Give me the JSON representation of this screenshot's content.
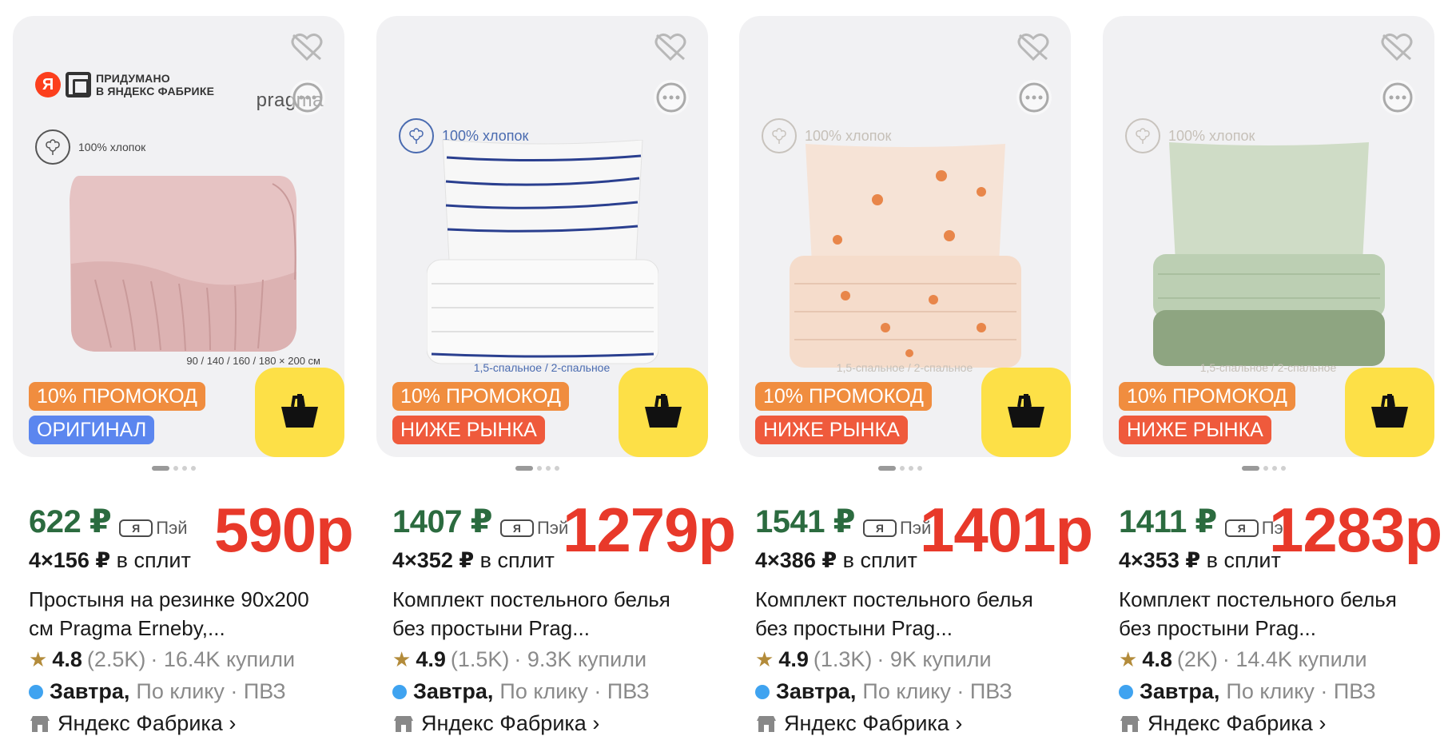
{
  "colors": {
    "price_green": "#2b6b3f",
    "big_price_red": "#e8392a",
    "promo_orange": "#f08d3f",
    "original_blue": "#5b86ef",
    "below_market_red": "#ef5a3c",
    "cart_yellow": "#fde047",
    "delivery_blue": "#3fa3f0"
  },
  "cards": [
    {
      "brand_line1": "ПРИДУМАНО",
      "brand_line2": "В ЯНДЕКС ФАБРИКЕ",
      "ya_letter": "Я",
      "pragma": "pragma",
      "cotton": "100% хлопок",
      "size_note": "90 / 140 / 160 / 180 × 200 см",
      "badge_top": "10% ПРОМОКОД",
      "badge_bottom": "ОРИГИНАЛ",
      "price": "622 ₽",
      "pay_label": "Пэй",
      "pay_icon": "Я",
      "big_price": "590р",
      "split_amount": "4×156 ₽",
      "split_label": "в сплит",
      "title": "Простыня на резинке 90x200 см Pragma Erneby,...",
      "rating": "4.8",
      "reviews": "(2.5K)",
      "bought": "· 16.4K купили",
      "delivery_day": "Завтра,",
      "delivery_rest": "По клику · ПВЗ",
      "store": "Яндекс Фабрика ›",
      "icons": [
        "heart-off-icon",
        "more-icon",
        "cart-icon",
        "star-icon",
        "store-icon"
      ]
    },
    {
      "cotton": "100% хлопок",
      "size_note": "1,5-спальное / 2-спальное",
      "badge_top": "10% ПРОМОКОД",
      "badge_bottom": "НИЖЕ РЫНКА",
      "price": "1407 ₽",
      "pay_label": "Пэй",
      "pay_icon": "Я",
      "big_price": "1279р",
      "split_amount": "4×352 ₽",
      "split_label": "в сплит",
      "title": "Комплект постельного белья без простыни Prag...",
      "rating": "4.9",
      "reviews": "(1.5K)",
      "bought": "· 9.3K купили",
      "delivery_day": "Завтра,",
      "delivery_rest": "По клику · ПВЗ",
      "store": "Яндекс Фабрика ›"
    },
    {
      "cotton": "100% хлопок",
      "size_note": "1,5-спальное / 2-спальное",
      "badge_top": "10% ПРОМОКОД",
      "badge_bottom": "НИЖЕ РЫНКА",
      "price": "1541 ₽",
      "pay_label": "Пэй",
      "pay_icon": "Я",
      "big_price": "1401р",
      "split_amount": "4×386 ₽",
      "split_label": "в сплит",
      "title": "Комплект постельного белья без простыни Prag...",
      "rating": "4.9",
      "reviews": "(1.3K)",
      "bought": "· 9K купили",
      "delivery_day": "Завтра,",
      "delivery_rest": "По клику · ПВЗ",
      "store": "Яндекс Фабрика ›"
    },
    {
      "cotton": "100% хлопок",
      "size_note": "1,5-спальное / 2-спальное",
      "badge_top": "10% ПРОМОКОД",
      "badge_bottom": "НИЖЕ РЫНКА",
      "price": "1411 ₽",
      "pay_label": "Пэй",
      "pay_icon": "Я",
      "big_price": "1283р",
      "split_amount": "4×353 ₽",
      "split_label": "в сплит",
      "title": "Комплект постельного белья без простыни Prag...",
      "rating": "4.8",
      "reviews": "(2K)",
      "bought": "· 14.4K купили",
      "delivery_day": "Завтра,",
      "delivery_rest": "По клику · ПВЗ",
      "store": "Яндекс Фабрика ›"
    }
  ]
}
